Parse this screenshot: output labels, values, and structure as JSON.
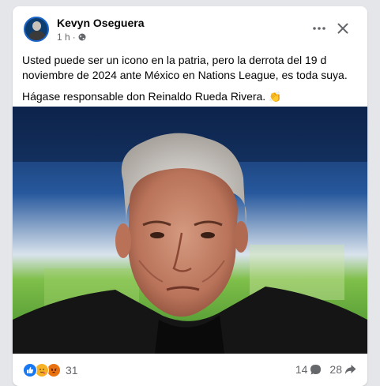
{
  "post": {
    "author": "Kevyn Oseguera",
    "time": "1 h",
    "separator": "·",
    "paragraphs": [
      "Usted puede ser un icono en la patria, pero la derrota del 19 d noviembre de 2024  ante México en Nations League, es toda suya.",
      "Hágase responsable don Reinaldo Rueda Rivera."
    ],
    "emoji": "👏"
  },
  "icons": {
    "more": "more-options-icon",
    "close": "close-icon",
    "privacy": "globe-icon",
    "comment": "comment-icon",
    "share": "share-icon"
  },
  "reactions": {
    "types": [
      "like",
      "care",
      "angry"
    ],
    "count": "31"
  },
  "engagement": {
    "comments": "14",
    "shares": "28"
  },
  "colors": {
    "like": "#1877f2",
    "care": "#f7b125",
    "angry": "#e9710f",
    "text": "#050505",
    "secondary": "#65676b"
  }
}
